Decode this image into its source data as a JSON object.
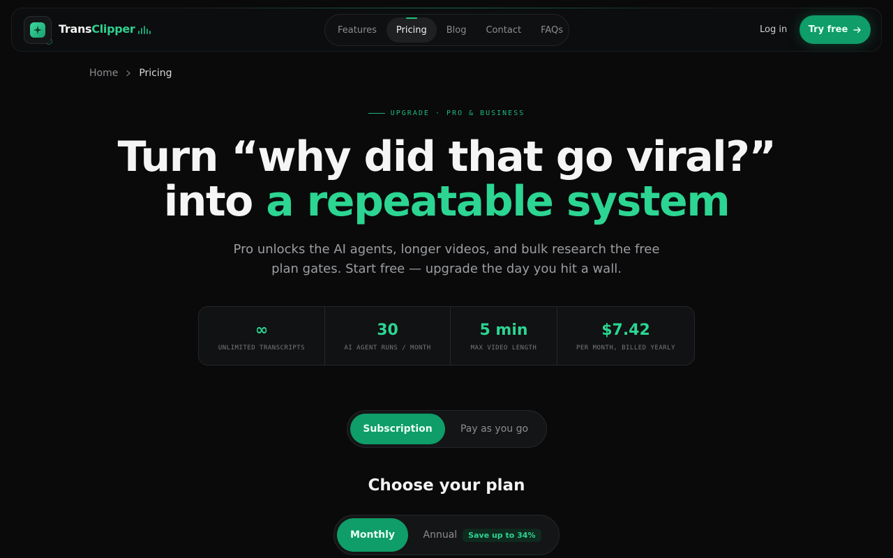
{
  "nav": {
    "brand_part1": "Trans",
    "brand_part2": "Clipper",
    "links": [
      "Features",
      "Pricing",
      "Blog",
      "Contact",
      "FAQs"
    ],
    "active_link": "Pricing",
    "login_label": "Log in",
    "cta_label": "Try free"
  },
  "breadcrumb": {
    "home": "Home",
    "current": "Pricing"
  },
  "hero": {
    "eyebrow": "UPGRADE · PRO & BUSINESS",
    "title_line1": "Turn “why did that go viral?”",
    "title_line2_prefix": "into ",
    "title_line2_highlight": "a repeatable system",
    "subtitle": "Pro unlocks the AI agents, longer videos, and bulk research the free plan gates. Start free — upgrade the day you hit a wall."
  },
  "stats": [
    {
      "value": "∞",
      "label": "UNLIMITED TRANSCRIPTS"
    },
    {
      "value": "30",
      "label": "AI AGENT RUNS / MONTH"
    },
    {
      "value": "5 min",
      "label": "MAX VIDEO LENGTH"
    },
    {
      "value": "$7.42",
      "label": "PER MONTH, BILLED YEARLY"
    }
  ],
  "billing_mode": {
    "options": [
      "Subscription",
      "Pay as you go"
    ],
    "selected": "Subscription"
  },
  "plans": {
    "title": "Choose your plan",
    "period_options": [
      "Monthly",
      "Annual"
    ],
    "selected_period": "Monthly",
    "annual_badge": "Save up to 34%"
  },
  "colors": {
    "accent": "#2cd592",
    "button": "#0f9d69",
    "background": "#0a0a0b"
  }
}
